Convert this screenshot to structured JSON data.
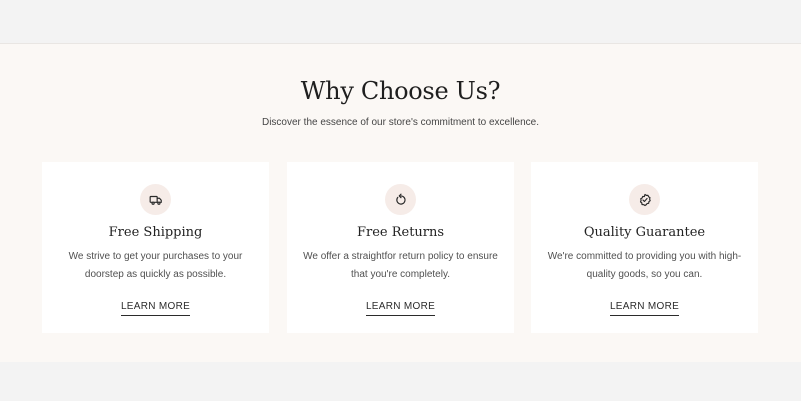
{
  "section": {
    "title": "Why Choose Us?",
    "subtitle": "Discover the essence of our store's commitment to excellence."
  },
  "features": [
    {
      "icon": "truck-icon",
      "title": "Free Shipping",
      "description": "We strive to get your purchases to your doorstep as quickly as possible.",
      "link_label": "LEARN MORE"
    },
    {
      "icon": "return-arrow-icon",
      "title": "Free Returns",
      "description": "We offer a straightfor return policy to ensure that you're completely.",
      "link_label": "LEARN MORE"
    },
    {
      "icon": "check-badge-icon",
      "title": "Quality Guarantee",
      "description": "We're committed to providing you with high-quality goods, so you can.",
      "link_label": "LEARN MORE"
    }
  ],
  "colors": {
    "page_background": "#f3f3f3",
    "section_background": "#fbf8f5",
    "card_background": "#ffffff",
    "icon_circle": "#f6ece8",
    "text_dark": "#1f1f1f"
  }
}
